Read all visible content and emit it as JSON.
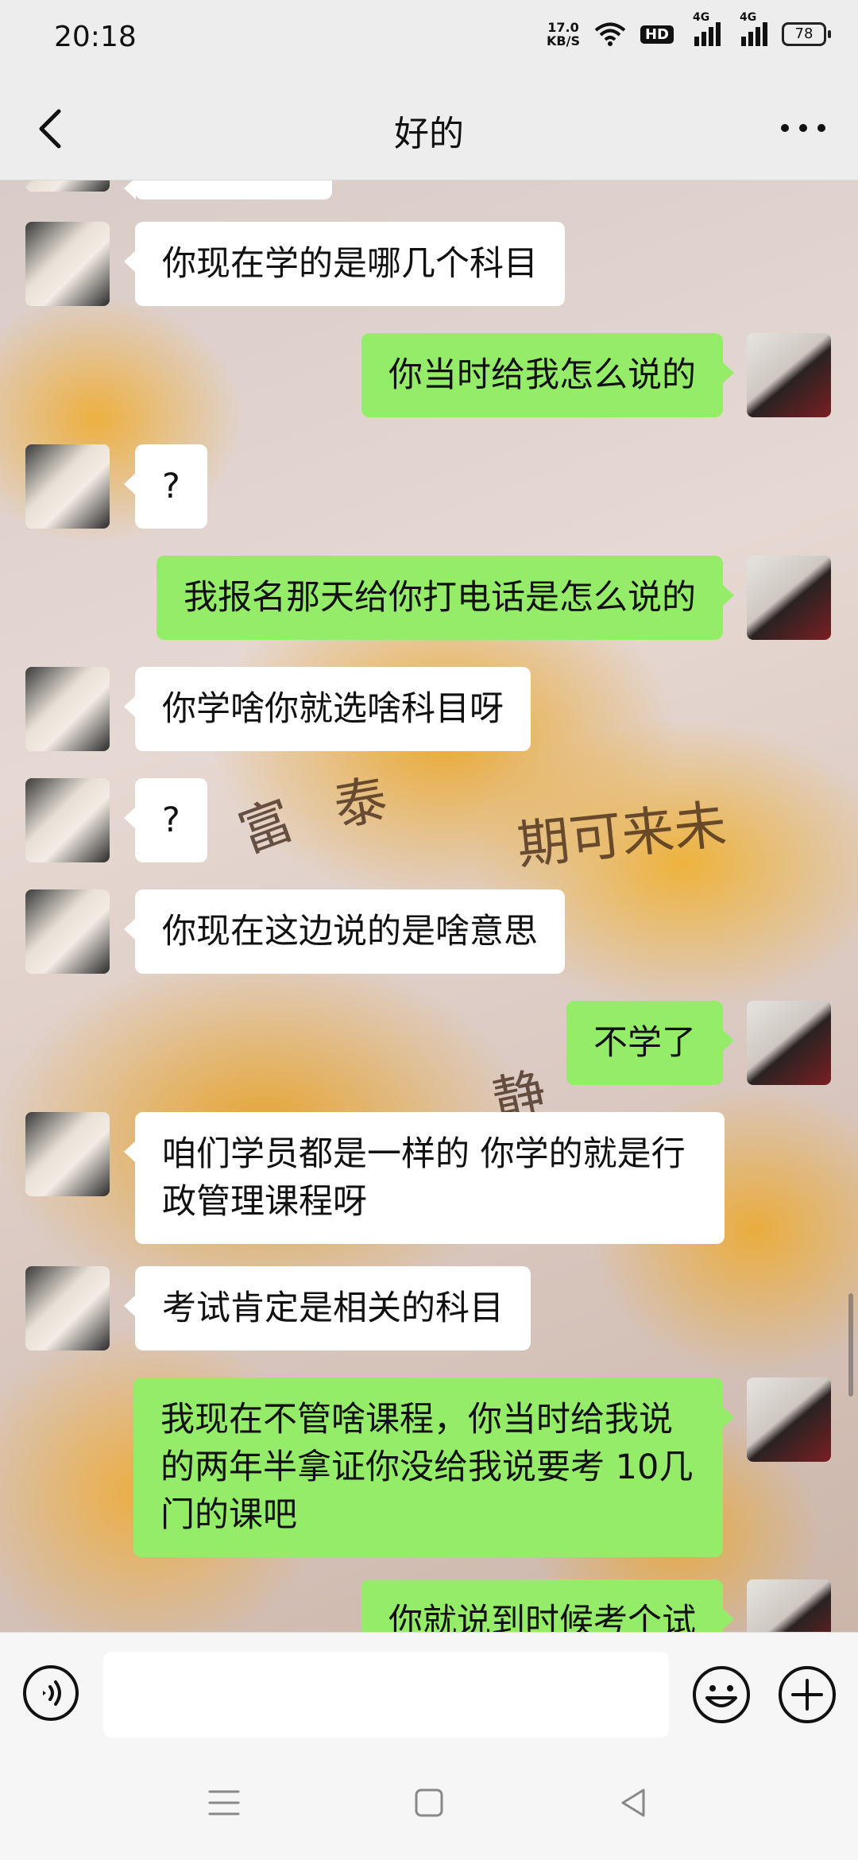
{
  "status_bar": {
    "time": "20:18",
    "net_speed_value": "17.0",
    "net_speed_unit": "KB/S",
    "hd_label": "HD",
    "signal1_label": "4G",
    "signal2_label": "4G",
    "battery": "78"
  },
  "header": {
    "title": "好的",
    "back_icon": "back-chevron-icon",
    "more_icon": "more-dots-icon"
  },
  "background": {
    "text_1": "期可来未",
    "text_2": "富",
    "text_3": "泰",
    "text_4": "静"
  },
  "messages": [
    {
      "sender": "them",
      "text": "你现在学的是哪几个科目"
    },
    {
      "sender": "me",
      "text": "你当时给我怎么说的"
    },
    {
      "sender": "them",
      "text": "?"
    },
    {
      "sender": "me",
      "text": "我报名那天给你打电话是怎么说的"
    },
    {
      "sender": "them",
      "text": "你学啥你就选啥科目呀"
    },
    {
      "sender": "them",
      "text": "?"
    },
    {
      "sender": "them",
      "text": "你现在这边说的是啥意思"
    },
    {
      "sender": "me",
      "text": "不学了"
    },
    {
      "sender": "them",
      "text": "咱们学员都是一样的 你学的就是行政管理课程呀"
    },
    {
      "sender": "them",
      "text": "考试肯定是相关的科目"
    },
    {
      "sender": "me",
      "text": "我现在不管啥课程，你当时给我说的两年半拿证你没给我说要考 10几门的课吧"
    },
    {
      "sender": "me",
      "text": "你就说到时候考个试"
    }
  ],
  "input_bar": {
    "voice_icon": "voice-icon",
    "message_value": "",
    "emoji_icon": "emoji-icon",
    "add_icon": "plus-circle-icon"
  },
  "nav_bar": {
    "menu_icon": "menu-icon",
    "home_icon": "home-square-icon",
    "back_icon": "back-triangle-icon"
  },
  "colors": {
    "my_bubble": "#95ec69",
    "their_bubble": "#ffffff",
    "bar_background": "#ededed"
  }
}
